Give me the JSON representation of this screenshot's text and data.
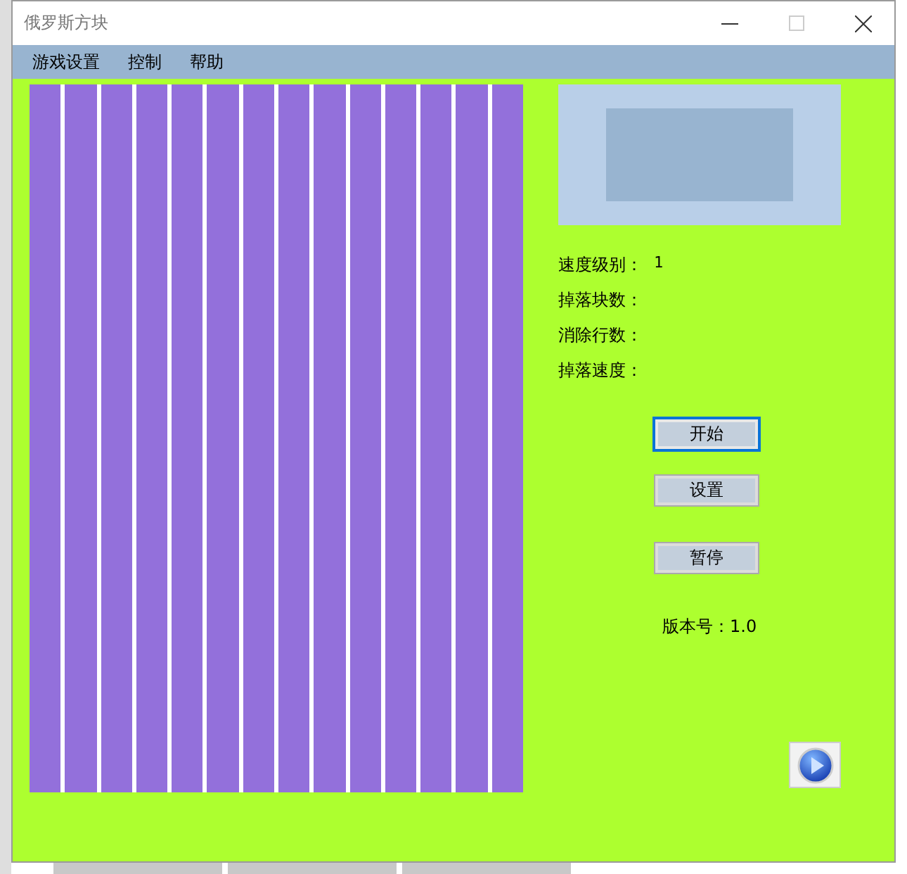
{
  "window": {
    "title": "俄罗斯方块"
  },
  "menu": [
    "游戏设置",
    "控制",
    "帮助"
  ],
  "stats": [
    {
      "label": "速度级别：",
      "value": "1"
    },
    {
      "label": "掉落块数："
    },
    {
      "label": "消除行数："
    },
    {
      "label": "掉落速度："
    }
  ],
  "buttons": [
    {
      "label": "开始",
      "focused": true
    },
    {
      "label": "设置",
      "focused": false
    },
    {
      "label": "暂停",
      "focused": false
    }
  ],
  "version": "版本号：1.0"
}
